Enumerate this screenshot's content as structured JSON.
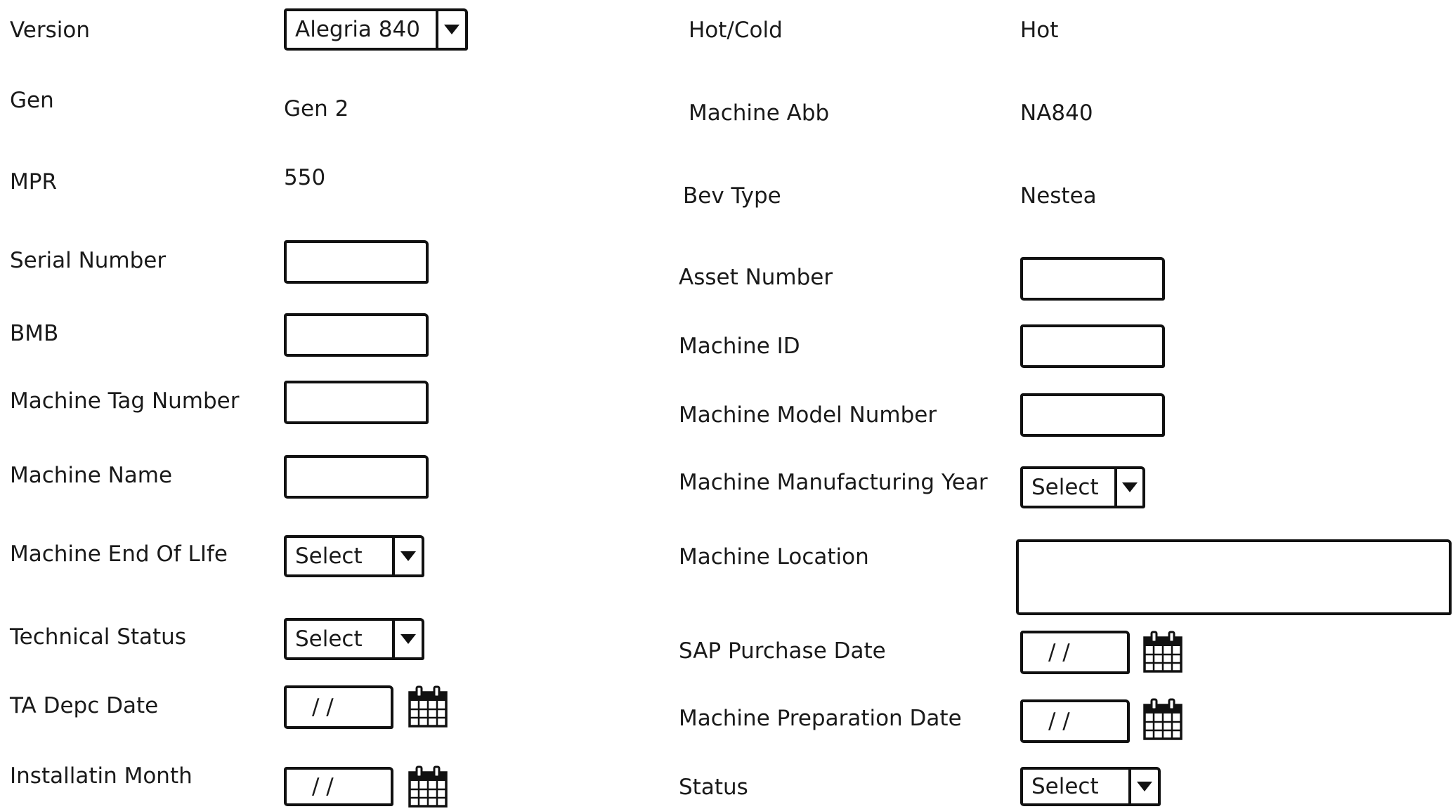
{
  "left": {
    "version_label": "Version",
    "version_value": "Alegria 840",
    "gen_label": "Gen",
    "gen_value": "Gen 2",
    "mpr_label": "MPR",
    "mpr_value": "550",
    "serial_label": "Serial Number",
    "bmb_label": "BMB",
    "tag_label": "Machine Tag Number",
    "name_label": "Machine Name",
    "eol_label": "Machine End Of LIfe",
    "eol_value": "Select",
    "tech_label": "Technical Status",
    "tech_value": "Select",
    "ta_label": "TA Depc Date",
    "ta_value": "/ /",
    "install_label": "Installatin Month",
    "install_value": "/ /"
  },
  "right": {
    "hotcold_label": "Hot/Cold",
    "hotcold_value": "Hot",
    "abb_label": "Machine Abb",
    "abb_value": "NA840",
    "bev_label": "Bev Type",
    "bev_value": "Nestea",
    "asset_label": "Asset Number",
    "machineid_label": "Machine ID",
    "model_label": "Machine Model Number",
    "year_label": "Machine Manufacturing Year",
    "year_value": "Select",
    "location_label": "Machine Location",
    "sap_label": "SAP Purchase Date",
    "sap_value": "/ /",
    "prep_label": "Machine Preparation Date",
    "prep_value": "/ /",
    "status_label": "Status",
    "status_value": "Select"
  },
  "icons": {
    "calendar": "calendar-icon",
    "dropdown": "chevron-down-icon"
  }
}
